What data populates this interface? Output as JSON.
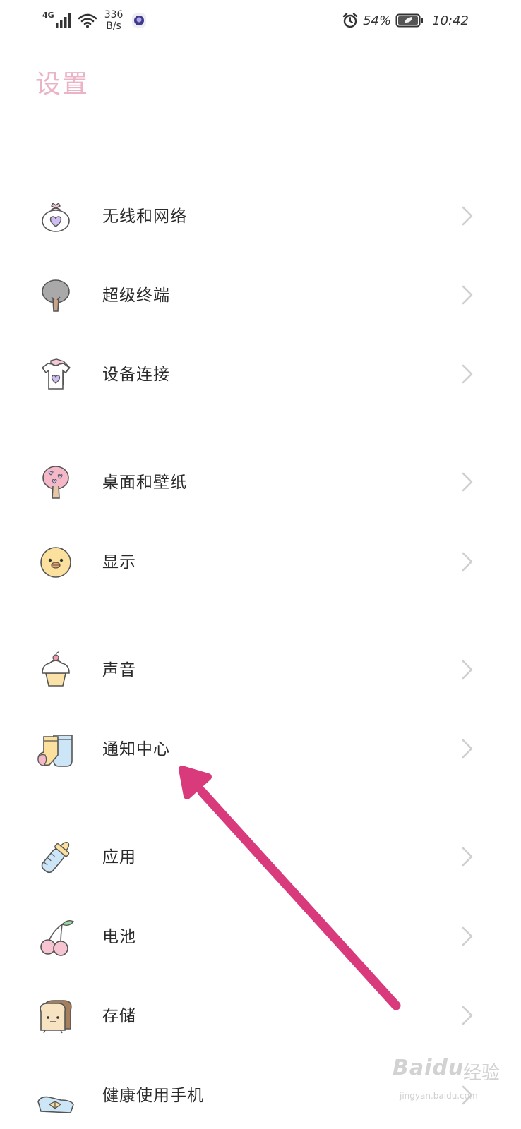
{
  "status_bar": {
    "network_type": "4G",
    "speed_value": "336",
    "speed_unit": "B/s",
    "battery": "54%",
    "time": "10:42"
  },
  "page": {
    "title": "设置"
  },
  "settings": [
    {
      "label": "无线和网络",
      "icon": "purse-heart-icon"
    },
    {
      "label": "超级终端",
      "icon": "tree-icon"
    },
    {
      "label": "设备连接",
      "icon": "shirt-icon"
    },
    {
      "label": "桌面和壁纸",
      "icon": "heart-tree-icon"
    },
    {
      "label": "显示",
      "icon": "duck-icon"
    },
    {
      "label": "声音",
      "icon": "cupcake-icon"
    },
    {
      "label": "通知中心",
      "icon": "socks-icon"
    },
    {
      "label": "应用",
      "icon": "baby-bottle-icon"
    },
    {
      "label": "电池",
      "icon": "cherry-icon"
    },
    {
      "label": "存储",
      "icon": "toast-icon"
    },
    {
      "label": "健康使用手机",
      "icon": "bow-icon"
    }
  ],
  "colors": {
    "title": "#ebb4c6",
    "arrow": "#d83a7c",
    "chevron": "#cfcfcf"
  },
  "watermark": {
    "brand": "Baidu",
    "suffix": "经验",
    "url": "jingyan.baidu.com"
  }
}
